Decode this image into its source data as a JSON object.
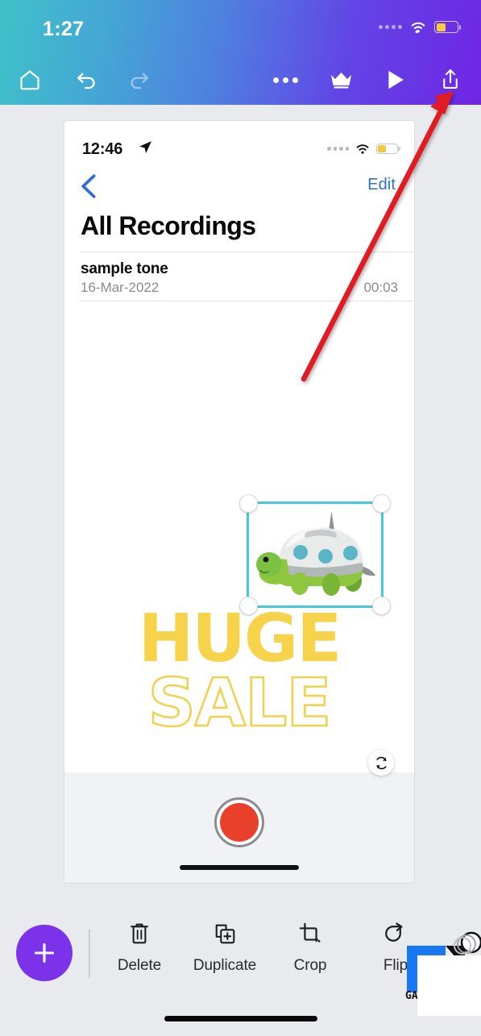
{
  "device_status_bar": {
    "time": "1:27",
    "signal_icon": "signal-dots-icon",
    "wifi_icon": "wifi-icon",
    "battery_icon": "battery-low-power-icon",
    "battery_color": "#f6cb3f"
  },
  "app_toolbar": {
    "gradient_start": "#3fc1c9",
    "gradient_end": "#6f26e3",
    "buttons": [
      {
        "name": "home",
        "icon": "home-icon",
        "enabled": true
      },
      {
        "name": "undo",
        "icon": "undo-icon",
        "enabled": true
      },
      {
        "name": "redo",
        "icon": "redo-icon",
        "enabled": false
      },
      {
        "name": "more",
        "icon": "more-horizontal-icon",
        "enabled": true
      },
      {
        "name": "pro",
        "icon": "crown-icon",
        "enabled": true
      },
      {
        "name": "play",
        "icon": "play-icon",
        "enabled": true
      },
      {
        "name": "share",
        "icon": "share-export-icon",
        "enabled": true
      }
    ]
  },
  "annotation": {
    "type": "arrow",
    "color": "#e01b22",
    "points_to": "share-export-icon"
  },
  "canvas": {
    "screenshot_layer": {
      "status_bar": {
        "time": "12:46",
        "location_icon": "location-arrow-icon",
        "signal_icon": "signal-dots-icon",
        "wifi_icon": "wifi-icon",
        "battery_icon": "battery-low-power-icon"
      },
      "nav": {
        "back_icon": "chevron-left-icon",
        "back_color": "#2f6fd0",
        "edit_label": "Edit",
        "edit_color": "#2f6fd0"
      },
      "title": "All Recordings",
      "recordings": [
        {
          "name": "sample tone",
          "date": "16-Mar-2022",
          "duration": "00:03"
        }
      ],
      "record_button": {
        "icon": "record-circle-icon",
        "fill": "#e8402a",
        "ring": "#8b8b90"
      },
      "home_indicator": true
    },
    "sticker": {
      "name": "turtle-sticker",
      "selected": true,
      "selection_border_color": "#45c8dd",
      "handles": [
        "top-left",
        "top-right",
        "bottom-left",
        "bottom-right"
      ],
      "rotate_handle_icon": "rotate-icon"
    },
    "headline": {
      "line1": "HUGE",
      "line1_style": "solid",
      "line1_color": "#f6d34b",
      "line2": "SALE",
      "line2_style": "outline",
      "line2_color": "#f0d14e"
    }
  },
  "bottom_toolbar": {
    "add_button": {
      "icon": "plus-icon",
      "color": "#7c32e8"
    },
    "tools": [
      {
        "label": "Delete",
        "icon": "trash-icon"
      },
      {
        "label": "Duplicate",
        "icon": "duplicate-icon"
      },
      {
        "label": "Crop",
        "icon": "crop-icon"
      },
      {
        "label": "Flip",
        "icon": "flip-icon"
      }
    ],
    "home_indicator": true
  },
  "watermark": {
    "name": "gadgets-to-use-watermark",
    "text": "GAD",
    "blue": "#1877f2",
    "black": "#111111"
  }
}
